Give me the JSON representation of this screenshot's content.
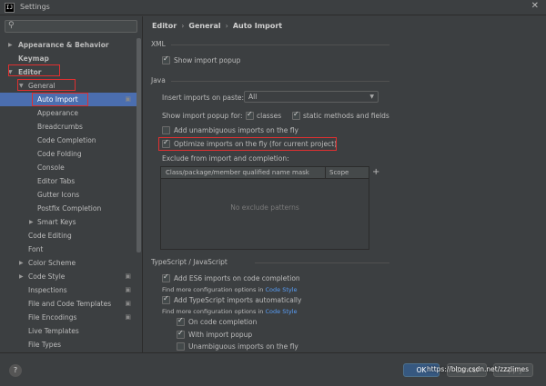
{
  "window": {
    "title": "Settings",
    "app_icon": "IJ",
    "close_glyph": "✕"
  },
  "search": {
    "icon": "search-icon",
    "value": ""
  },
  "tree": {
    "items": [
      {
        "label": "Appearance & Behavior",
        "bold": true
      },
      {
        "label": "Keymap",
        "bold": true
      },
      {
        "label": "Editor",
        "bold": true
      },
      {
        "label": "General"
      },
      {
        "label": "Auto Import",
        "selected": true
      },
      {
        "label": "Appearance"
      },
      {
        "label": "Breadcrumbs"
      },
      {
        "label": "Code Completion"
      },
      {
        "label": "Code Folding"
      },
      {
        "label": "Console"
      },
      {
        "label": "Editor Tabs"
      },
      {
        "label": "Gutter Icons"
      },
      {
        "label": "Postfix Completion"
      },
      {
        "label": "Smart Keys"
      },
      {
        "label": "Code Editing"
      },
      {
        "label": "Font"
      },
      {
        "label": "Color Scheme"
      },
      {
        "label": "Code Style"
      },
      {
        "label": "Inspections"
      },
      {
        "label": "File and Code Templates"
      },
      {
        "label": "File Encodings"
      },
      {
        "label": "Live Templates"
      },
      {
        "label": "File Types"
      }
    ]
  },
  "breadcrumb": {
    "part1": "Editor",
    "part2": "General",
    "part3": "Auto Import",
    "sep": "›"
  },
  "xml": {
    "title": "XML",
    "show_import_popup": "Show import popup"
  },
  "java": {
    "title": "Java",
    "insert_imports_label": "Insert imports on paste:",
    "insert_imports_value": "All",
    "show_popup_for_label": "Show import popup for:",
    "classes_label": "classes",
    "static_label": "static methods and fields",
    "add_unambiguous": "Add unambiguous imports on the fly",
    "optimize": "Optimize imports on the fly (for current project)",
    "exclude_label": "Exclude from import and completion:",
    "col_name": "Class/package/member qualified name mask",
    "col_scope": "Scope",
    "empty_text": "No exclude patterns",
    "add_glyph": "+"
  },
  "typescript": {
    "title": "TypeScript / JavaScript",
    "add_es6": "Add ES6 imports on code completion",
    "more_options_prefix": "Find more configuration options in",
    "code_style_link": "Code Style",
    "add_ts": "Add TypeScript imports automatically",
    "on_completion": "On code completion",
    "with_popup": "With import popup",
    "unambiguous_fly": "Unambiguous imports on the fly"
  },
  "buttons": {
    "help": "?",
    "ok": "OK",
    "cancel": "Cancel",
    "apply": "Apply"
  },
  "watermark": "https://blog.csdn.net/zzzlimes"
}
